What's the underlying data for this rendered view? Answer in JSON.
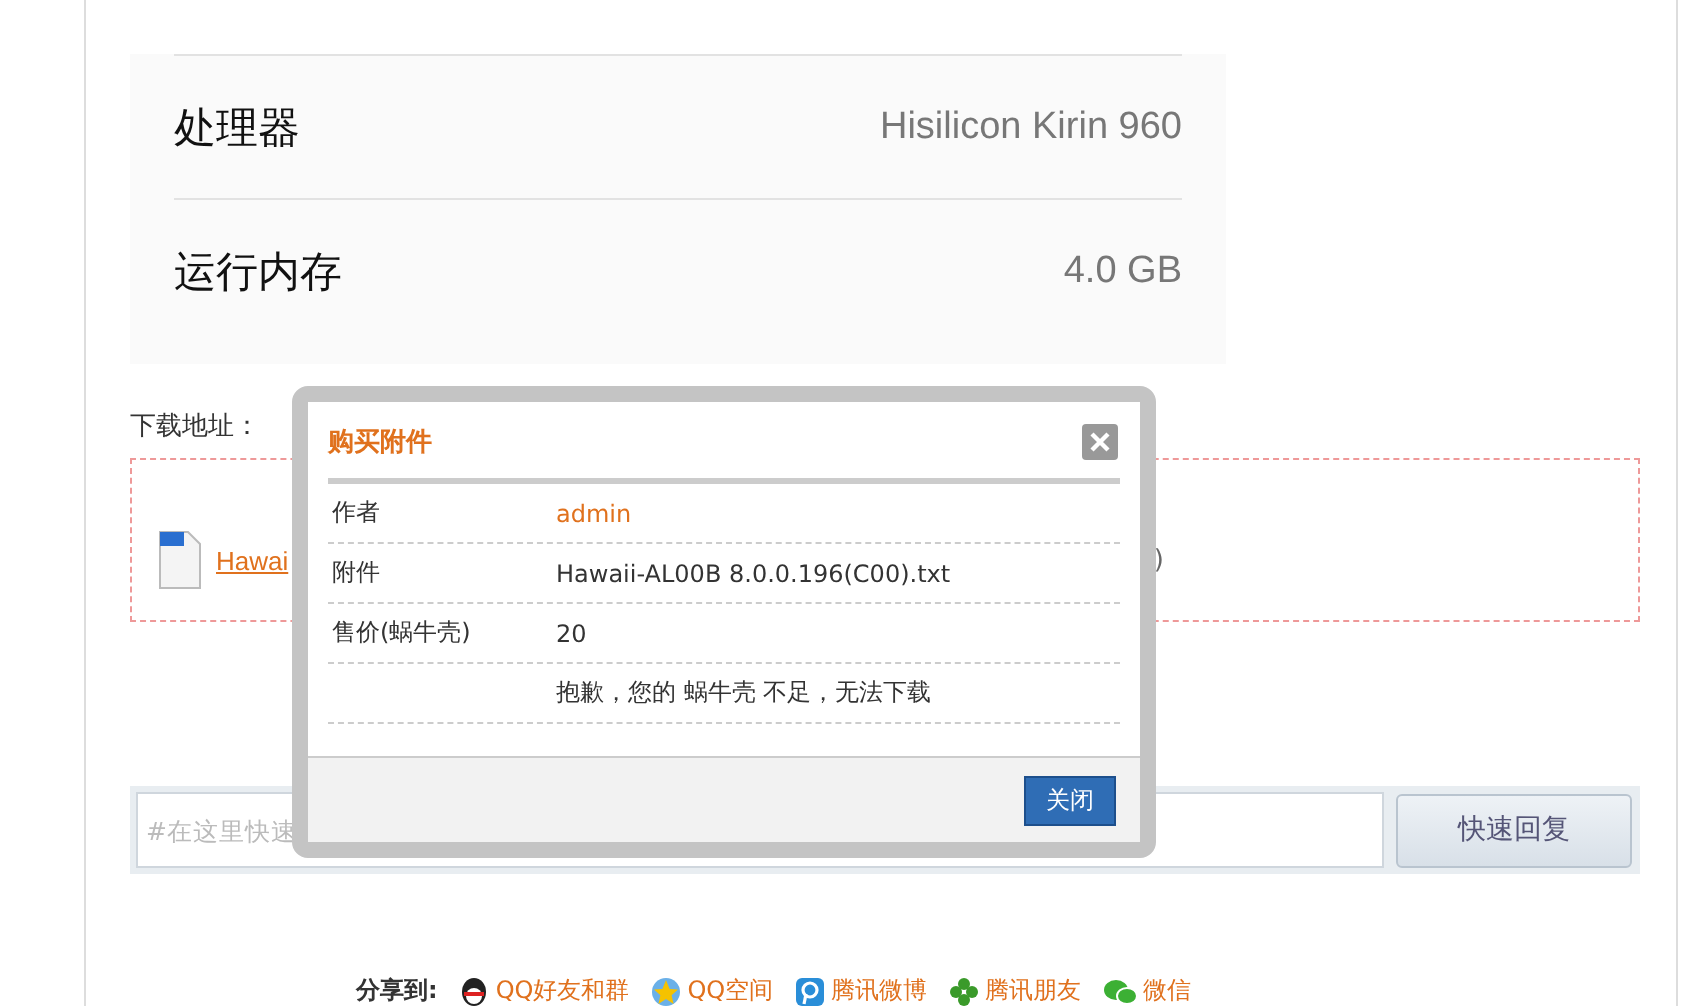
{
  "spec_rows": [
    {
      "label": "处理器",
      "value": "Hisilicon Kirin 960"
    },
    {
      "label": "运行内存",
      "value": "4.0 GB"
    }
  ],
  "download": {
    "label": "下载地址：",
    "link_visible": "Hawai",
    "link_tail": ")"
  },
  "reply": {
    "placeholder": "#在这里快速",
    "button": "快速回复"
  },
  "share": {
    "label": "分享到:",
    "items": [
      {
        "kind": "qq",
        "label": "QQ好友和群"
      },
      {
        "kind": "qzone",
        "label": "QQ空间"
      },
      {
        "kind": "weibo",
        "label": "腾讯微博"
      },
      {
        "kind": "pengyou",
        "label": "腾讯朋友"
      },
      {
        "kind": "wechat",
        "label": "微信"
      }
    ]
  },
  "dialog": {
    "title": "购买附件",
    "rows": [
      {
        "label": "作者",
        "value": "admin",
        "kind": "link"
      },
      {
        "label": "附件",
        "value": "Hawaii-AL00B 8.0.0.196(C00).txt",
        "kind": "text"
      },
      {
        "label": "售价(蜗牛壳)",
        "value": "20",
        "kind": "text"
      },
      {
        "label": "",
        "value": "抱歉，您的 蜗牛壳 不足，无法下载",
        "kind": "text"
      }
    ],
    "close_button": "关闭"
  }
}
